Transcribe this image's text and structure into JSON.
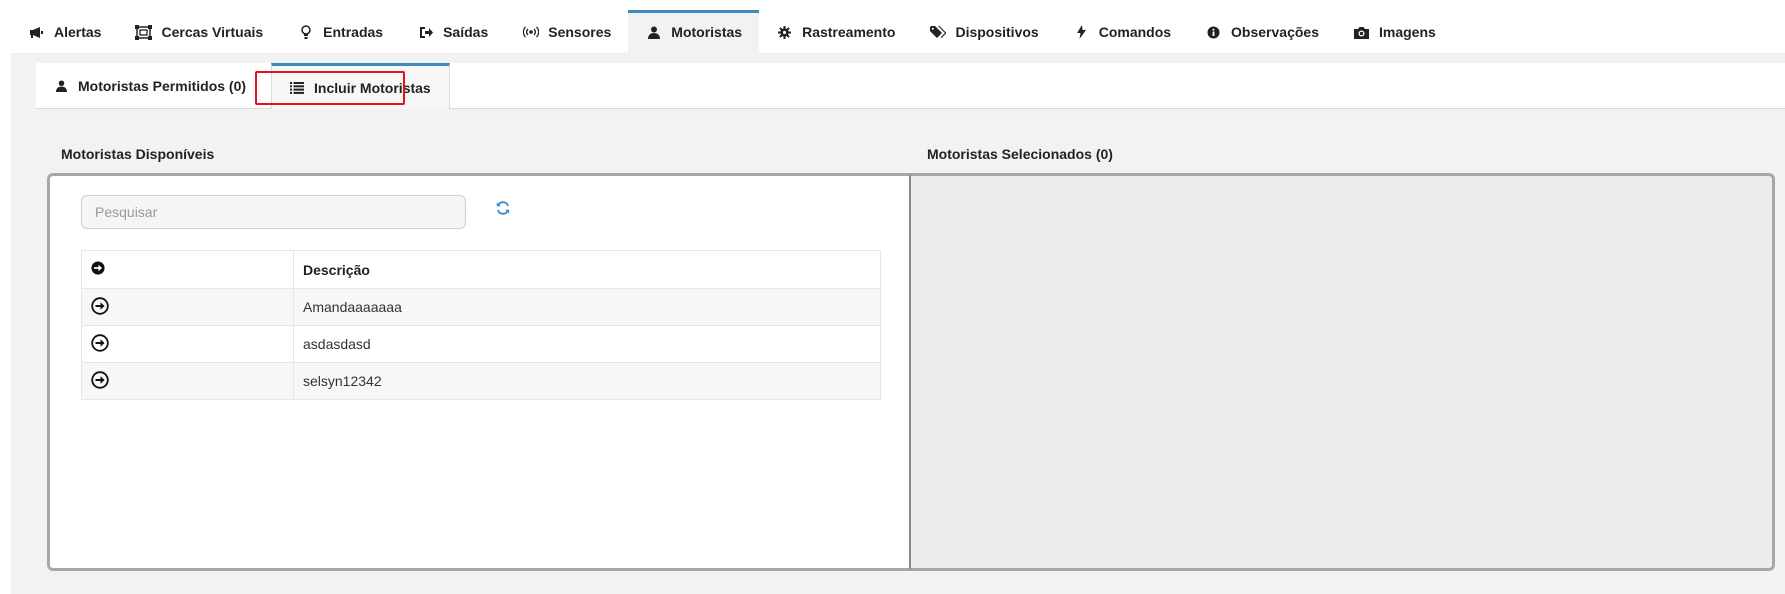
{
  "top_tabs": [
    {
      "label": "Alertas",
      "icon": "bullhorn-icon",
      "active": false
    },
    {
      "label": "Cercas Virtuais",
      "icon": "object-group-icon",
      "active": false
    },
    {
      "label": "Entradas",
      "icon": "lightbulb-icon",
      "active": false
    },
    {
      "label": "Saídas",
      "icon": "sign-out-icon",
      "active": false
    },
    {
      "label": "Sensores",
      "icon": "broadcast-icon",
      "active": false
    },
    {
      "label": "Motoristas",
      "icon": "user-icon",
      "active": true
    },
    {
      "label": "Rastreamento",
      "icon": "gear-icon",
      "active": false
    },
    {
      "label": "Dispositivos",
      "icon": "tags-icon",
      "active": false
    },
    {
      "label": "Comandos",
      "icon": "bolt-icon",
      "active": false
    },
    {
      "label": "Observações",
      "icon": "info-circle-icon",
      "active": false
    },
    {
      "label": "Imagens",
      "icon": "camera-icon",
      "active": false
    }
  ],
  "sub_tabs": [
    {
      "label": "Motoristas Permitidos (0)",
      "icon": "user-icon",
      "active": false
    },
    {
      "label": "Incluir Motoristas",
      "icon": "list-icon",
      "active": true
    }
  ],
  "left_panel": {
    "title": "Motoristas Disponíveis",
    "search_placeholder": "Pesquisar",
    "refresh_icon": "refresh-icon",
    "table": {
      "header_icon": "arrow-circle-right-icon",
      "column_header": "Descrição",
      "rows": [
        {
          "description": "Amandaaaaaaa"
        },
        {
          "description": "asdasdasd"
        },
        {
          "description": "selsyn12342"
        }
      ]
    }
  },
  "right_panel": {
    "title": "Motoristas Selecionados (0)"
  },
  "colors": {
    "accent": "#3c8dbc",
    "highlight": "#e3131b",
    "panel_border": "#a8a8a8",
    "background": "#f2f2f2"
  }
}
